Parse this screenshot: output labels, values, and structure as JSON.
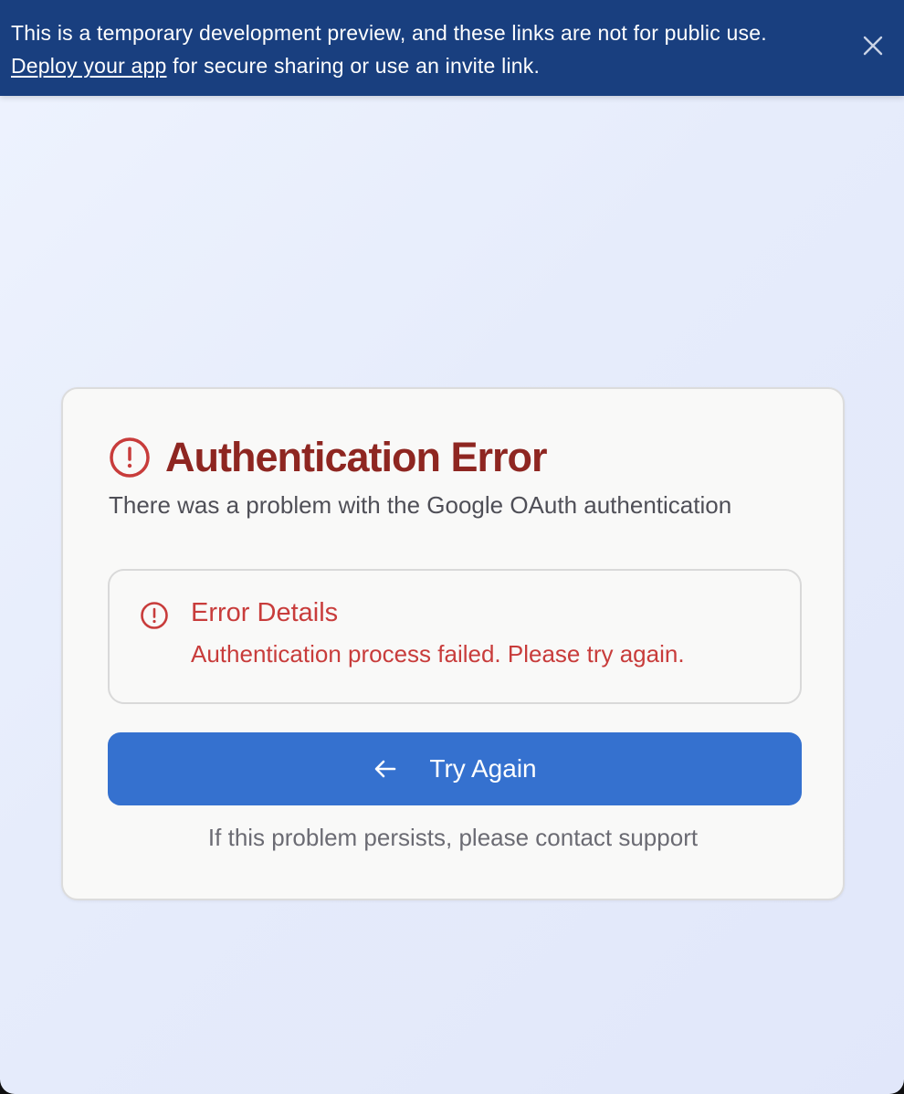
{
  "banner": {
    "message": "This is a temporary development preview, and these links are not for public use.",
    "link_text": "Deploy your app",
    "message_suffix": " for secure sharing or use an invite link.",
    "close_icon": "close-icon"
  },
  "card": {
    "title": "Authentication Error",
    "title_icon": "alert-circle-icon",
    "subtitle": "There was a problem with the Google OAuth authentication",
    "details": {
      "icon": "alert-circle-icon",
      "title": "Error Details",
      "message": "Authentication process failed. Please try again."
    },
    "button": {
      "icon": "arrow-left-icon",
      "label": "Try Again"
    },
    "footer": "If this problem persists, please contact support"
  },
  "colors": {
    "banner_bg": "#193f7f",
    "title": "#8e2621",
    "error_text": "#c83c3b",
    "button_bg": "#3571cf"
  }
}
